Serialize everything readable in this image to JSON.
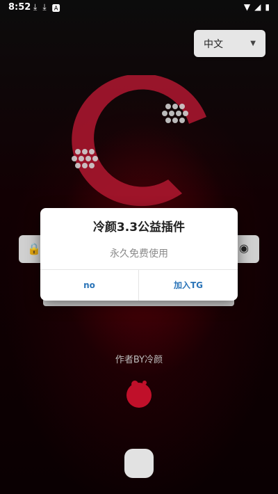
{
  "status_bar": {
    "time": "8:52",
    "left_icons": [
      "download-icon",
      "download-icon",
      "text-a-icon"
    ],
    "right_icons": [
      "wifi-icon",
      "signal-icon",
      "battery-icon"
    ]
  },
  "language_select": {
    "value": "中文"
  },
  "dialog": {
    "title": "冷颜3.3公益插件",
    "message": "永久免费使用",
    "buttons": {
      "no": "no",
      "join_tg": "加入TG"
    }
  },
  "author": "作者BY冷颜",
  "colors": {
    "accent_red": "#c0102a",
    "dialog_button": "#2a74b8",
    "background": "#000000"
  }
}
